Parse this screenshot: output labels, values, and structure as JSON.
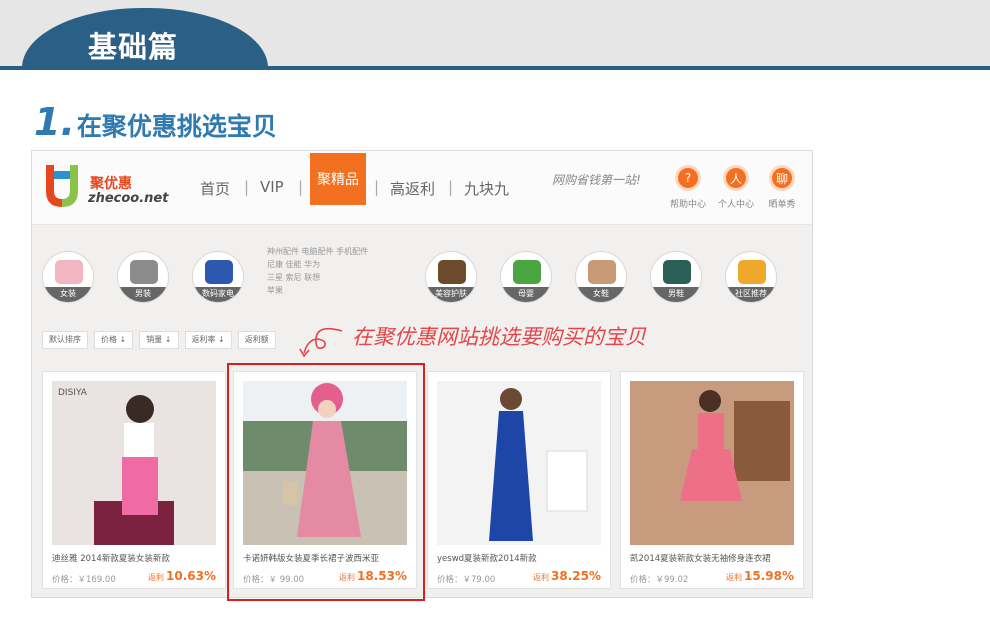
{
  "section": {
    "label": "基础篇"
  },
  "step": {
    "number": "1.",
    "title": "在聚优惠挑选宝贝"
  },
  "site": {
    "logo_cn": "聚优惠",
    "logo_en": "zhecoo.net",
    "nav": [
      {
        "label": "首页"
      },
      {
        "label": "VIP"
      },
      {
        "label": "聚精品",
        "active": true
      },
      {
        "label": "高返利"
      },
      {
        "label": "九块九"
      }
    ],
    "slogan": "网购省钱第一站!",
    "utilities": [
      {
        "icon": "help-icon",
        "glyph": "?",
        "label": "帮助中心"
      },
      {
        "icon": "user-icon",
        "glyph": "人",
        "label": "个人中心"
      },
      {
        "icon": "chat-icon",
        "glyph": "聊",
        "label": "晒单秀"
      }
    ],
    "categories": [
      {
        "label": "女装",
        "color": "#f2b7c2"
      },
      {
        "label": "男装",
        "color": "#8c8c8c"
      },
      {
        "label": "数码家电",
        "color": "#2e57b0"
      },
      {
        "label": "美容护肤",
        "color": "#6b4b2b"
      },
      {
        "label": "母婴",
        "color": "#4aa640"
      },
      {
        "label": "女鞋",
        "color": "#c99a78"
      },
      {
        "label": "男鞋",
        "color": "#2b5f55"
      },
      {
        "label": "社区推荐",
        "color": "#f0a82b"
      }
    ],
    "brands": [
      "神州配件",
      "电脑配件",
      "手机配件",
      "尼康",
      "佳能",
      "华为",
      "三星",
      "索尼",
      "联想",
      "苹果"
    ],
    "sort_options": [
      "默认排序",
      "价格 ↓",
      "销量 ↓",
      "返利率 ↓",
      "返利额"
    ],
    "callout": "在聚优惠网站挑选要购买的宝贝",
    "products": [
      {
        "title": "迪丝雅 2014新款夏装女装新款",
        "price": "价格：￥169.00",
        "rebate_label": "返利",
        "rebate": "10.63%",
        "palette": [
          "#e9e4e1",
          "#f06ba3",
          "#7a2240"
        ]
      },
      {
        "title": "卡诺妍韩版女装夏季长裙子波西米亚",
        "price": "价格：￥ 99.00",
        "rebate_label": "返利",
        "rebate": "18.53%",
        "palette": [
          "#9fb2a0",
          "#e48aa2",
          "#d7c4a6"
        ]
      },
      {
        "title": "yeswd夏装新款2014新款",
        "price": "价格：￥79.00",
        "rebate_label": "返利",
        "rebate": "38.25%",
        "palette": [
          "#f3f3f3",
          "#1d46a8",
          "#d9d9d9"
        ]
      },
      {
        "title": "凯2014夏装新款女装无袖修身连衣裙",
        "price": "价格：￥99.02",
        "rebate_label": "返利",
        "rebate": "15.98%",
        "palette": [
          "#c89b7e",
          "#ee6f88",
          "#8a5a3c"
        ]
      }
    ]
  },
  "colors": {
    "brand_blue": "#2a5f86",
    "accent_orange": "#f37021",
    "highlight_red": "#d8211f"
  }
}
